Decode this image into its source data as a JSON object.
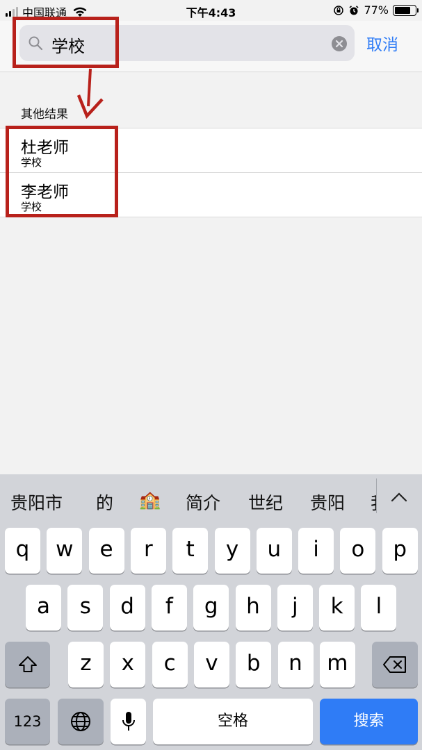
{
  "status_bar": {
    "carrier": "中国联通",
    "time": "下午4:43",
    "battery": "77%",
    "battery_level": 0.77
  },
  "search": {
    "query": "学校",
    "cancel_label": "取消"
  },
  "results": {
    "section_title": "其他结果",
    "items": [
      {
        "name": "杜老师",
        "subtitle": "学校"
      },
      {
        "name": "李老师",
        "subtitle": "学校"
      }
    ]
  },
  "keyboard": {
    "suggestions": [
      "贵阳市",
      "的",
      "🏫",
      "简介",
      "世纪",
      "贵阳",
      "我"
    ],
    "row1": [
      "q",
      "w",
      "e",
      "r",
      "t",
      "y",
      "u",
      "i",
      "o",
      "p"
    ],
    "row2": [
      "a",
      "s",
      "d",
      "f",
      "g",
      "h",
      "j",
      "k",
      "l"
    ],
    "row3": [
      "z",
      "x",
      "c",
      "v",
      "b",
      "n",
      "m"
    ],
    "numbers_label": "123",
    "space_label": "空格",
    "search_label": "搜索"
  },
  "colors": {
    "accent": "#2f7cf6",
    "annotation_red": "#b8211b"
  }
}
